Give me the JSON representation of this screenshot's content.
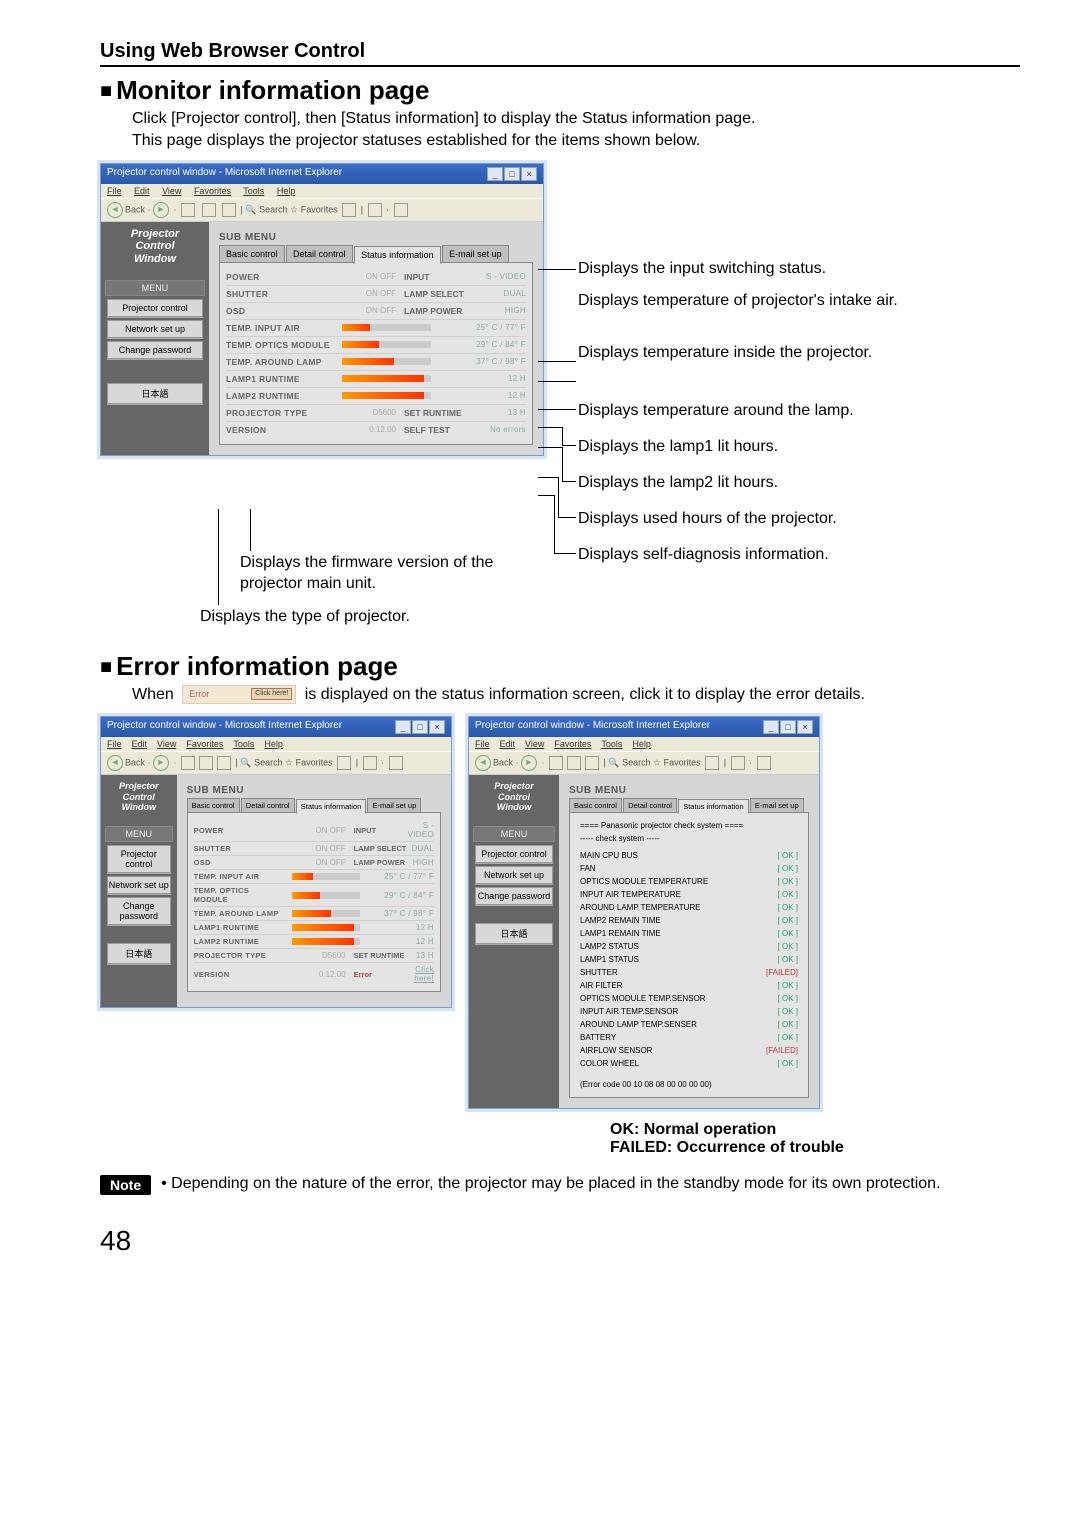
{
  "section_header": "Using Web Browser Control",
  "monitor": {
    "heading": "Monitor information page",
    "intro1": "Click [Projector control], then [Status information] to display the Status information page.",
    "intro2": "This page displays the projector statuses established for the items shown below.",
    "ie_title": "Projector control window - Microsoft Internet Explorer",
    "ie_menu": {
      "f": "File",
      "e": "Edit",
      "v": "View",
      "fa": "Favorites",
      "t": "Tools",
      "h": "Help"
    },
    "ie_tool": {
      "back": "Back",
      "search": "Search",
      "fav": "Favorites"
    },
    "sidebar": {
      "brand1": "Projector",
      "brand2": "Control",
      "brand3": "Window",
      "menu_label": "MENU",
      "projector_control": "Projector control",
      "network_setup": "Network set up",
      "change_password": "Change password",
      "japanese": "日本語"
    },
    "submenu": "SUB MENU",
    "tabs": {
      "basic": "Basic control",
      "detail": "Detail control",
      "status": "Status information",
      "email": "E-mail set up"
    },
    "rows": {
      "power": {
        "k": "POWER",
        "k2": "ON    OFF",
        "m": "INPUT",
        "v": "S - VIDEO"
      },
      "shutter": {
        "k": "SHUTTER",
        "k2": "ON    OFF",
        "m": "LAMP SELECT",
        "v": "DUAL"
      },
      "osd": {
        "k": "OSD",
        "k2": "ON    OFF",
        "m": "LAMP POWER",
        "v": "HIGH"
      },
      "tia": {
        "k": "TEMP. INPUT AIR",
        "val": "25° C / 77° F",
        "fill": 32
      },
      "tom": {
        "k": "TEMP. OPTICS MODULE",
        "val": "29° C / 84° F",
        "fill": 42
      },
      "tal": {
        "k": "TEMP. AROUND LAMP",
        "val": "37° C / 98° F",
        "fill": 58
      },
      "l1": {
        "k": "LAMP1 RUNTIME",
        "val": "12 H",
        "fill": 92
      },
      "l2": {
        "k": "LAMP2 RUNTIME",
        "val": "12 H",
        "fill": 92
      },
      "ptype": {
        "k": "PROJECTOR TYPE",
        "k2": "D5600",
        "m": "SET RUNTIME",
        "v": "13 H"
      },
      "ver": {
        "k": "VERSION",
        "k2": "0.12.00",
        "m": "SELF TEST",
        "v": "No errors"
      }
    },
    "callouts": {
      "input": "Displays the input switching status.",
      "intake": "Displays temperature of projector's intake air.",
      "inside": "Displays temperature inside the projector.",
      "around": "Displays temperature around the lamp.",
      "lamp1": "Displays the lamp1 lit hours.",
      "lamp2": "Displays the lamp2 lit hours.",
      "used": "Displays used hours of the projector.",
      "self": "Displays self-diagnosis information.",
      "fw": "Displays the firmware version of the projector main unit.",
      "type": "Displays the type of projector."
    }
  },
  "error": {
    "heading": "Error information page",
    "pretext": "When ",
    "badge_text": "Error",
    "badge_click": "Click here!",
    "posttext": " is displayed on the status information screen, click it to display the error details.",
    "status_ver_val": "Error",
    "checksys_title": "==== Panasonic projector check system ====",
    "checksys_sub": "----- check system -----",
    "items": [
      {
        "n": "MAIN CPU BUS",
        "s": "[ OK ]"
      },
      {
        "n": "FAN",
        "s": "[ OK ]"
      },
      {
        "n": "OPTICS MODULE TEMPERATURE",
        "s": "[ OK ]"
      },
      {
        "n": "INPUT AIR TEMPERATURE",
        "s": "[ OK ]"
      },
      {
        "n": "AROUND LAMP TEMPERATURE",
        "s": "[ OK ]"
      },
      {
        "n": "LAMP2 REMAIN TIME",
        "s": "[ OK ]"
      },
      {
        "n": "LAMP1 REMAIN TIME",
        "s": "[ OK ]"
      },
      {
        "n": "LAMP2 STATUS",
        "s": "[ OK ]"
      },
      {
        "n": "LAMP1 STATUS",
        "s": "[ OK ]"
      },
      {
        "n": "SHUTTER",
        "s": "[FAILED]"
      },
      {
        "n": "AIR FILTER",
        "s": "[ OK ]"
      },
      {
        "n": "OPTICS MODULE TEMP.SENSOR",
        "s": "[ OK ]"
      },
      {
        "n": "INPUT AIR TEMP.SENSOR",
        "s": "[ OK ]"
      },
      {
        "n": "AROUND LAMP TEMP.SENSER",
        "s": "[ OK ]"
      },
      {
        "n": "BATTERY",
        "s": "[ OK ]"
      },
      {
        "n": "AIRFLOW SENSOR",
        "s": "[FAILED]"
      },
      {
        "n": "COLOR WHEEL",
        "s": "[ OK ]"
      }
    ],
    "errcode": "(Error code 00 10 08 08 00 00 00 00)",
    "legend1": "OK: Normal operation",
    "legend2": "FAILED: Occurrence of trouble"
  },
  "note": {
    "label": "Note",
    "text": "• Depending on the nature of the error, the projector may be placed in the standby mode for its own protection."
  },
  "page_number": "48"
}
